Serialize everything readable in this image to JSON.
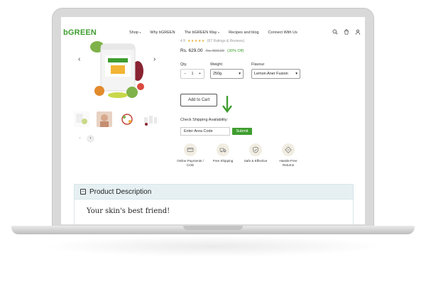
{
  "brand": {
    "logo_text": "bGREEN",
    "accent_color": "#3f9d2f"
  },
  "nav": {
    "items": [
      {
        "label": "Shop",
        "dropdown": true
      },
      {
        "label": "Why bGREEN",
        "dropdown": false
      },
      {
        "label": "The bGREEN Way",
        "dropdown": true
      },
      {
        "label": "Recipes and blog",
        "dropdown": false
      },
      {
        "label": "Connect With Us",
        "dropdown": false
      }
    ],
    "icons": [
      "search-icon",
      "cart-icon",
      "user-icon"
    ]
  },
  "product": {
    "rating_value": "4.9",
    "rating_count": "(67 Ratings & Reviews)",
    "price": "Rs. 629.00",
    "old_price": "Rs. 899.00",
    "discount": "(30% Off)",
    "qty_label": "Qty.",
    "qty_value": "1",
    "weight_label": "Weight",
    "weight_value": "250g",
    "flavour_label": "Flavour",
    "flavour_value": "Lemon Aner Fusion",
    "add_to_cart": "Add to Cart",
    "shipping_label": "Check Shipping Availability:",
    "area_placeholder": "Enter Area Code",
    "submit_label": "Submit"
  },
  "features": [
    {
      "icon": "card-icon",
      "label": "Online Payments / COD"
    },
    {
      "icon": "truck-icon",
      "label": "Free Shipping"
    },
    {
      "icon": "shield-icon",
      "label": "Safe & Effective"
    },
    {
      "icon": "return-icon",
      "label": "Hassle-Free Returns"
    }
  ],
  "description": {
    "title": "Product Description",
    "subtitle": "Your skin's best friend!"
  }
}
